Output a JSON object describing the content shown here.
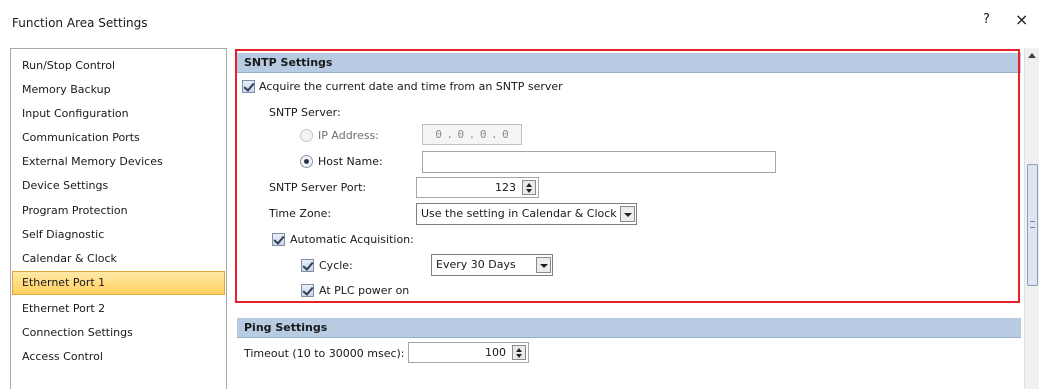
{
  "window": {
    "title": "Function Area Settings",
    "help_label": "?",
    "close_label": "×"
  },
  "nav": {
    "items": [
      {
        "label": "Run/Stop Control"
      },
      {
        "label": "Memory Backup"
      },
      {
        "label": "Input Configuration"
      },
      {
        "label": "Communication Ports"
      },
      {
        "label": "External Memory Devices"
      },
      {
        "label": "Device Settings"
      },
      {
        "label": "Program Protection"
      },
      {
        "label": "Self Diagnostic"
      },
      {
        "label": "Calendar & Clock"
      },
      {
        "label": "Ethernet Port 1",
        "selected": true
      },
      {
        "label": "Ethernet Port 2"
      },
      {
        "label": "Connection Settings"
      },
      {
        "label": "Access Control"
      }
    ]
  },
  "sntp": {
    "header": "SNTP Settings",
    "acquire_label": "Acquire the current date and time from an SNTP server",
    "acquire_checked": true,
    "server_label": "SNTP Server:",
    "ip_label": "IP Address:",
    "ip_octets": [
      "0",
      ".",
      "0",
      ".",
      "0",
      ".",
      "0"
    ],
    "host_label": "Host Name:",
    "host_value": "",
    "port_label": "SNTP Server Port:",
    "port_value": "123",
    "timezone_label": "Time Zone:",
    "timezone_value": "Use the setting in Calendar & Clock",
    "auto_label": "Automatic Acquisition:",
    "auto_checked": true,
    "cycle_label": "Cycle:",
    "cycle_checked": true,
    "cycle_value": "Every 30 Days",
    "plc_label": "At PLC power on",
    "plc_checked": true
  },
  "ping": {
    "header": "Ping Settings",
    "timeout_label": "Timeout (10 to 30000 msec):",
    "timeout_value": "100"
  },
  "colors": {
    "highlight_border": "#e52028",
    "section_header_bg": "#b7cbe3",
    "nav_selected_bg": "#ffcf5e"
  }
}
